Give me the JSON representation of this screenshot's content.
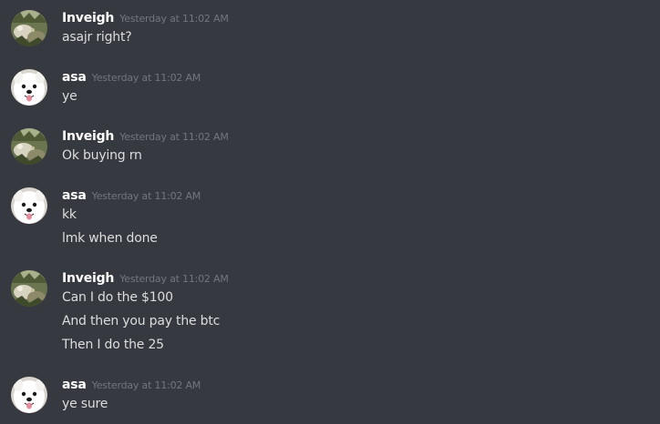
{
  "users": {
    "inveigh": {
      "name": "Inveigh",
      "avatar_icon": "nature-photo-avatar-icon"
    },
    "asa": {
      "name": "asa",
      "avatar_icon": "white-dog-avatar-icon"
    }
  },
  "colors": {
    "background": "#36393f",
    "username": "#ffffff",
    "timestamp": "#72767d",
    "message_text": "#dcddde"
  },
  "groups": [
    {
      "author": "Inveigh",
      "timestamp": "Yesterday at 11:02 AM",
      "messages": [
        "asajr right?"
      ]
    },
    {
      "author": "asa",
      "timestamp": "Yesterday at 11:02 AM",
      "messages": [
        "ye"
      ]
    },
    {
      "author": "Inveigh",
      "timestamp": "Yesterday at 11:02 AM",
      "messages": [
        "Ok buying rn"
      ]
    },
    {
      "author": "asa",
      "timestamp": "Yesterday at 11:02 AM",
      "messages": [
        "kk",
        "lmk when done"
      ]
    },
    {
      "author": "Inveigh",
      "timestamp": "Yesterday at 11:02 AM",
      "messages": [
        "Can I do the $100",
        "And then you pay the btc",
        "Then I do the 25"
      ]
    },
    {
      "author": "asa",
      "timestamp": "Yesterday at 11:02 AM",
      "messages": [
        "ye sure"
      ]
    }
  ]
}
